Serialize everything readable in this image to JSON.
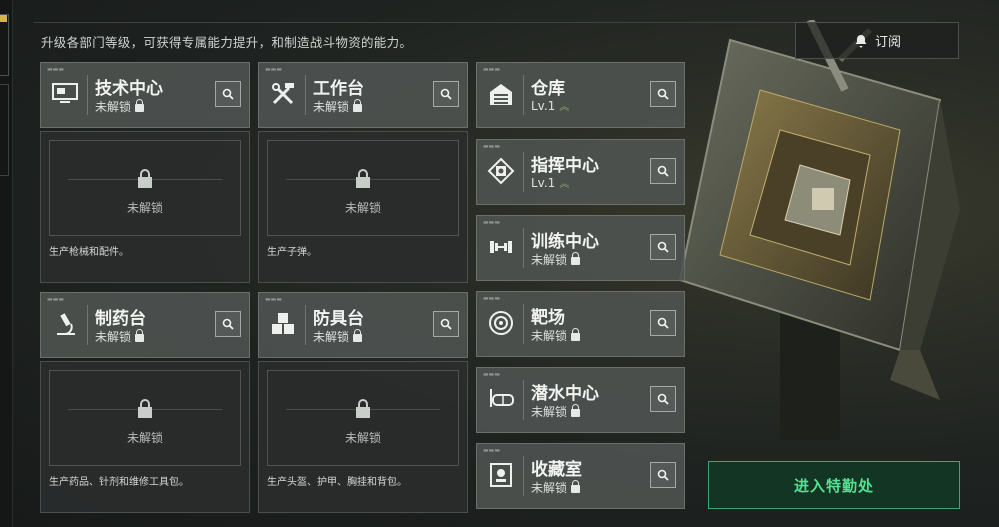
{
  "subtitle": "升级各部门等级，可获得专属能力提升，和制造战斗物资的能力。",
  "subscribe_label": "订阅",
  "enter_button_label": "进入特勤处",
  "left_departments": [
    {
      "title": "技术中心",
      "status": "未解锁",
      "icon": "monitor-icon",
      "locked_label": "未解锁",
      "description": "生产枪械和配件。"
    },
    {
      "title": "工作台",
      "status": "未解锁",
      "icon": "tools-icon",
      "locked_label": "未解锁",
      "description": "生产子弹。"
    },
    {
      "title": "制药台",
      "status": "未解锁",
      "icon": "microscope-icon",
      "locked_label": "未解锁",
      "description": "生产药品、针剂和维修工具包。"
    },
    {
      "title": "防具台",
      "status": "未解锁",
      "icon": "armor-blocks-icon",
      "locked_label": "未解锁",
      "description": "生产头盔、护甲、胸挂和背包。"
    }
  ],
  "right_departments": [
    {
      "title": "仓库",
      "status": "Lv.1",
      "icon": "warehouse-icon",
      "locked": false
    },
    {
      "title": "指挥中心",
      "status": "Lv.1",
      "icon": "chip-icon",
      "locked": false
    },
    {
      "title": "训练中心",
      "status": "未解锁",
      "icon": "dumbbell-icon",
      "locked": true
    },
    {
      "title": "靶场",
      "status": "未解锁",
      "icon": "target-icon",
      "locked": true
    },
    {
      "title": "潜水中心",
      "status": "未解锁",
      "icon": "diving-mask-icon",
      "locked": true
    },
    {
      "title": "收藏室",
      "status": "未解锁",
      "icon": "collection-icon",
      "locked": true
    }
  ]
}
